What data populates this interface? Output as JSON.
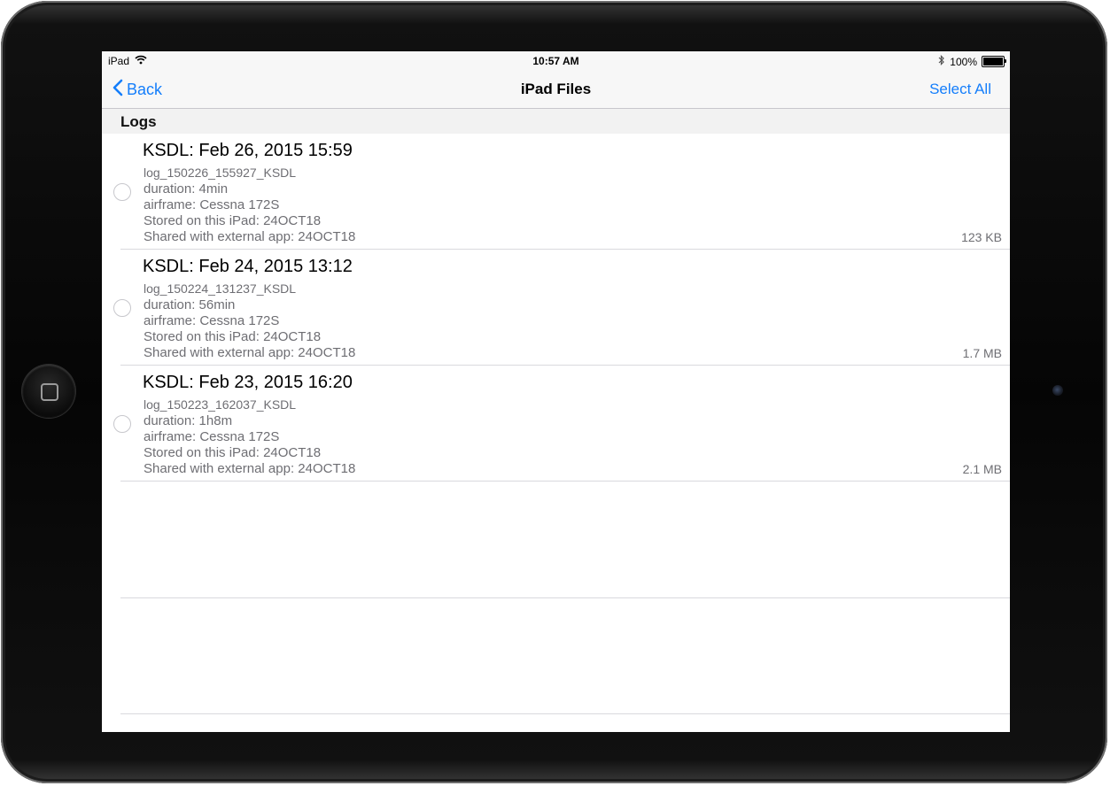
{
  "statusbar": {
    "device": "iPad",
    "time": "10:57 AM",
    "battery": "100%"
  },
  "navbar": {
    "back_label": "Back",
    "title": "iPad Files",
    "select_all_label": "Select All"
  },
  "section": {
    "title": "Logs"
  },
  "files": [
    {
      "title": "KSDL: Feb 26, 2015 15:59",
      "filename": "log_150226_155927_KSDL",
      "duration": "duration: 4min",
      "airframe": "airframe: Cessna 172S",
      "stored": "Stored on this iPad: 24OCT18",
      "shared": "Shared with external app: 24OCT18",
      "size": "123 KB"
    },
    {
      "title": "KSDL: Feb 24, 2015 13:12",
      "filename": "log_150224_131237_KSDL",
      "duration": "duration: 56min",
      "airframe": "airframe: Cessna 172S",
      "stored": "Stored on this iPad: 24OCT18",
      "shared": "Shared with external app: 24OCT18",
      "size": "1.7 MB"
    },
    {
      "title": "KSDL: Feb 23, 2015 16:20",
      "filename": "log_150223_162037_KSDL",
      "duration": "duration: 1h8m",
      "airframe": "airframe: Cessna 172S",
      "stored": "Stored on this iPad: 24OCT18",
      "shared": "Shared with external app: 24OCT18",
      "size": "2.1 MB"
    }
  ],
  "colors": {
    "accent": "#147efb",
    "secondary_text": "#6e6e73",
    "separator": "#d9d9de"
  },
  "icons": {
    "back": "chevron-left-icon",
    "wifi": "wifi-icon",
    "bluetooth": "bluetooth-icon",
    "battery": "battery-icon",
    "home": "home-button-icon"
  }
}
